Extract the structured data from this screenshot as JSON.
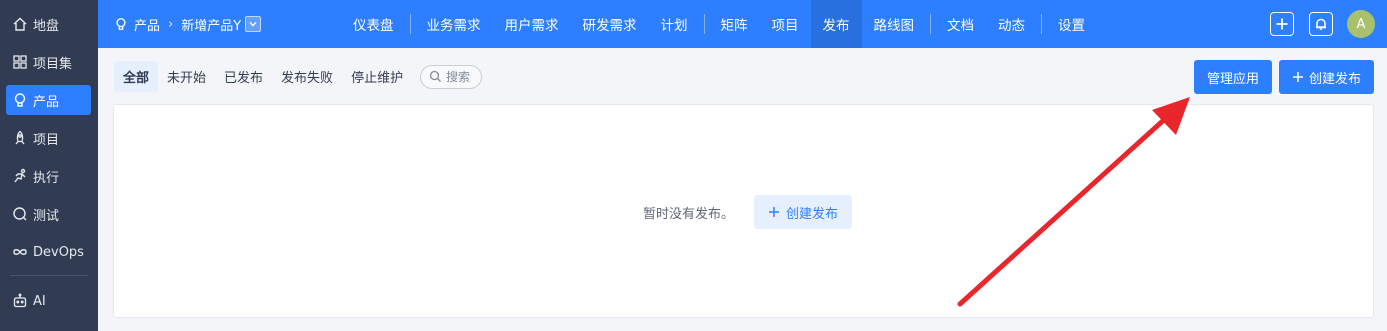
{
  "sidebar": {
    "items": [
      {
        "label": "地盘",
        "icon": "home-icon"
      },
      {
        "label": "项目集",
        "icon": "grid-icon"
      },
      {
        "label": "产品",
        "icon": "bulb-icon"
      },
      {
        "label": "项目",
        "icon": "rocket-icon"
      },
      {
        "label": "执行",
        "icon": "run-icon"
      },
      {
        "label": "测试",
        "icon": "test-icon"
      },
      {
        "label": "DevOps",
        "icon": "infinity-icon"
      },
      {
        "label": "AI",
        "icon": "robot-icon"
      }
    ]
  },
  "header": {
    "crumb_product": "产品",
    "crumb_current": "新增产品Y",
    "nav": [
      "仪表盘",
      "业务需求",
      "用户需求",
      "研发需求",
      "计划",
      "矩阵",
      "项目",
      "发布",
      "路线图",
      "文档",
      "动态",
      "设置"
    ],
    "active_nav": "发布",
    "avatar_letter": "A"
  },
  "filters": {
    "tabs": [
      "全部",
      "未开始",
      "已发布",
      "发布失败",
      "停止维护"
    ],
    "search_label": "搜索"
  },
  "actions": {
    "manage_label": "管理应用",
    "create_label": "创建发布"
  },
  "empty": {
    "text": "暂时没有发布。",
    "create_label": "创建发布"
  },
  "colors": {
    "primary": "#2e7fff",
    "sidebar_bg": "#313c52",
    "annotation_arrow": "#e8262c"
  }
}
